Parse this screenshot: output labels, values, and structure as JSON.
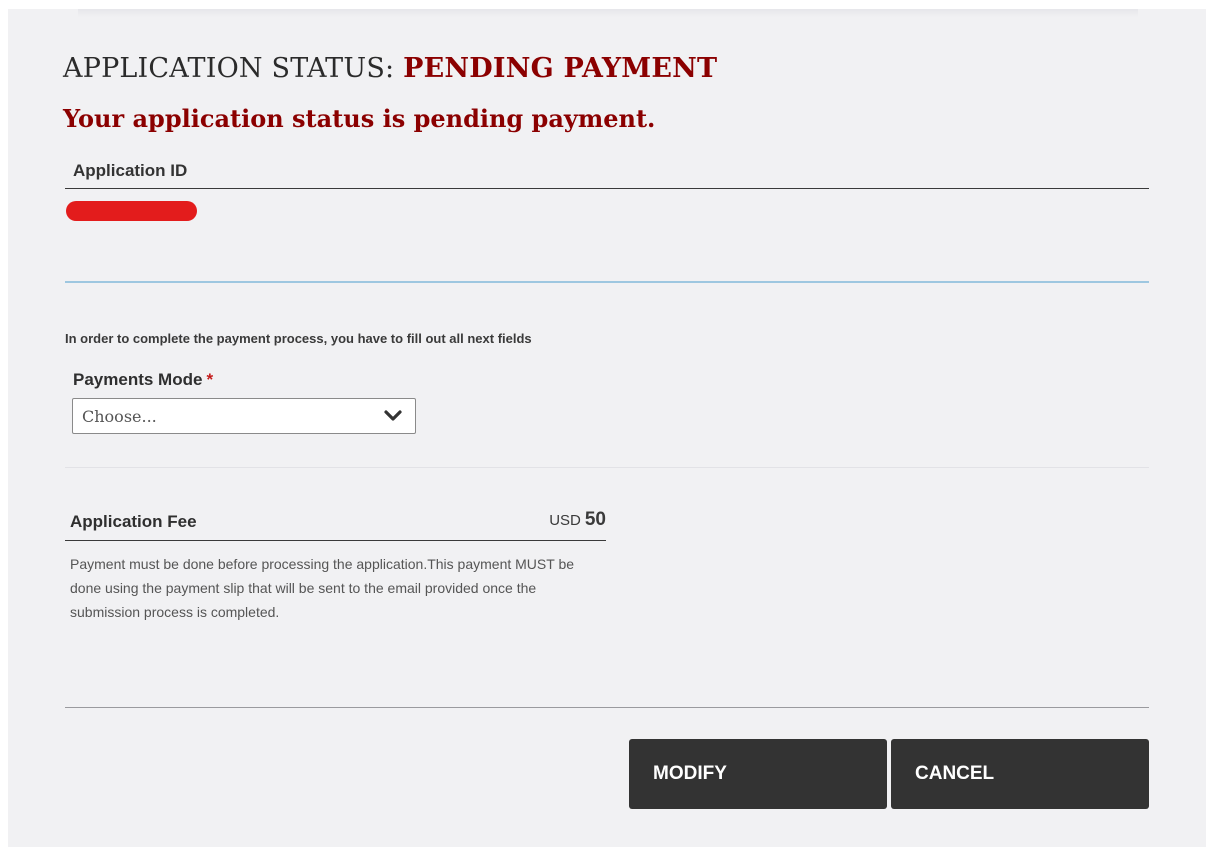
{
  "status": {
    "heading_prefix": "APPLICATION STATUS:",
    "heading_value": "PENDING PAYMENT",
    "message": "Your application status is pending payment.",
    "accent_color": "#8b0000"
  },
  "application_id": {
    "label": "Application ID"
  },
  "payment": {
    "instruction": "In order to complete the payment process, you have to fill out all next fields",
    "mode_label": "Payments Mode",
    "required_marker": "*",
    "mode_selected": "Choose..."
  },
  "fee": {
    "label": "Application Fee",
    "currency": "USD",
    "amount": "50",
    "note": "Payment must be done before processing the application.This payment MUST be done using the payment slip that will be sent to the email provided once the submission process is completed."
  },
  "actions": {
    "modify_label": "MODIFY",
    "cancel_label": "CANCEL"
  },
  "icons": {
    "select_chevron": "chevron-down-icon"
  }
}
